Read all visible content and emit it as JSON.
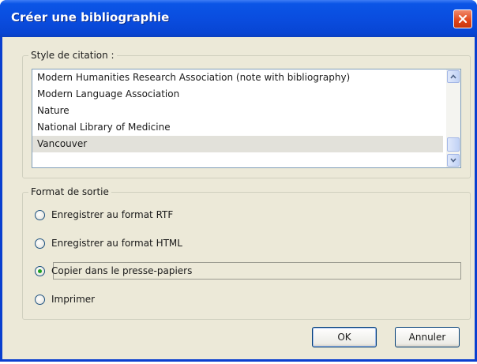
{
  "window": {
    "title": "Créer une bibliographie"
  },
  "citation_style": {
    "legend": "Style de citation :",
    "items": [
      "Modern Humanities Research Association (note with bibliography)",
      "Modern Language Association",
      "Nature",
      "National Library of Medicine",
      "Vancouver"
    ],
    "selected": "Vancouver"
  },
  "output_format": {
    "legend": "Format de sortie",
    "options": [
      "Enregistrer au format RTF",
      "Enregistrer au format HTML",
      "Copier dans le presse-papiers",
      "Imprimer"
    ],
    "selected": "Copier dans le presse-papiers"
  },
  "buttons": {
    "ok": "OK",
    "cancel": "Annuler"
  },
  "colors": {
    "titlebar": "#0a4ddf",
    "close_button": "#e04418",
    "dialog_background": "#ece9d8",
    "radio_checked": "#21a121"
  },
  "icons": {
    "close": "close-icon",
    "scroll_up": "chevron-up-icon",
    "scroll_down": "chevron-down-icon"
  }
}
